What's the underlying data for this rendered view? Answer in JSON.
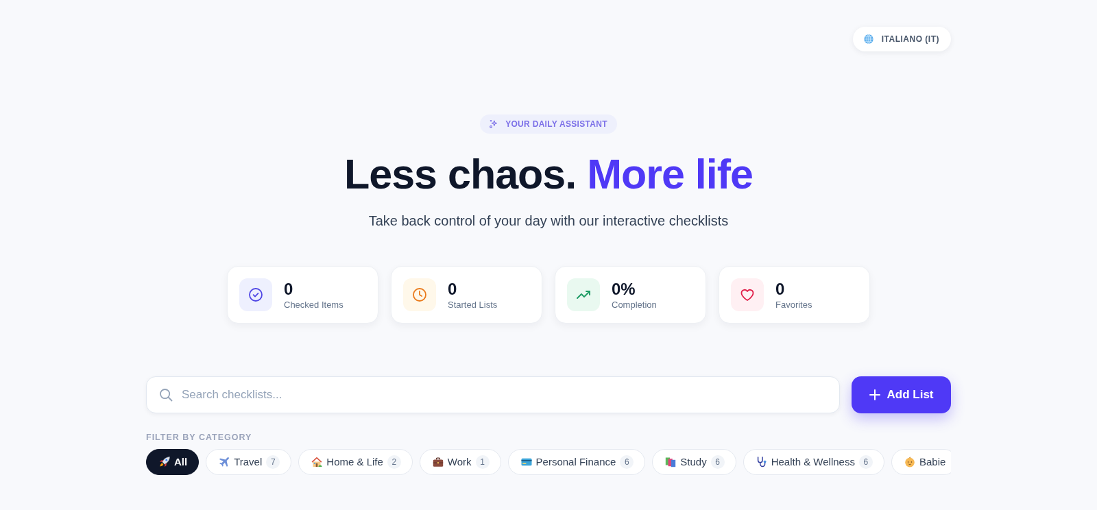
{
  "language_button": {
    "label": "ITALIANO (IT)"
  },
  "hero": {
    "tagline": "YOUR DAILY ASSISTANT",
    "title": "Less chaos.",
    "title_accent": "More life",
    "subtitle": "Take back control of your day with our interactive checklists"
  },
  "stats": [
    {
      "value": "0",
      "label": "Checked Items"
    },
    {
      "value": "0",
      "label": "Started Lists"
    },
    {
      "value": "0%",
      "label": "Completion"
    },
    {
      "value": "0",
      "label": "Favorites"
    }
  ],
  "search": {
    "placeholder": "Search checklists..."
  },
  "add_button": {
    "label": "Add List"
  },
  "filter": {
    "heading": "FILTER BY CATEGORY",
    "categories": [
      {
        "label": "All",
        "selected": true
      },
      {
        "label": "Travel",
        "count": "7",
        "selected": false
      },
      {
        "label": "Home & Life",
        "count": "2",
        "selected": false
      },
      {
        "label": "Work",
        "count": "1",
        "selected": false
      },
      {
        "label": "Personal Finance",
        "count": "6",
        "selected": false
      },
      {
        "label": "Study",
        "count": "6",
        "selected": false
      },
      {
        "label": "Health & Wellness",
        "count": "6",
        "selected": false
      },
      {
        "label": "Babie",
        "selected": false
      }
    ]
  }
}
